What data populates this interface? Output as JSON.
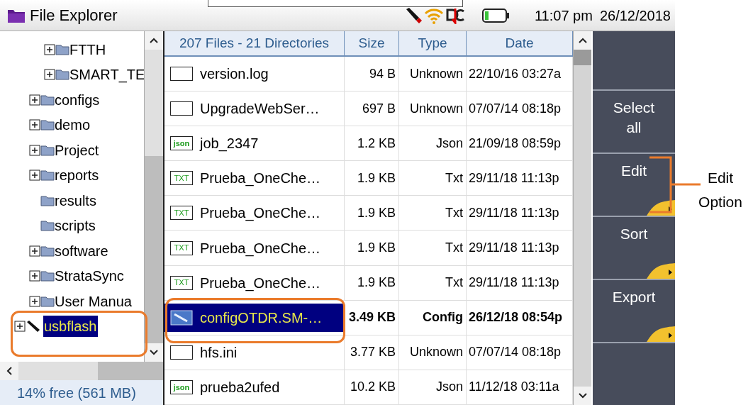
{
  "window": {
    "title": "File Explorer"
  },
  "status_bar": {
    "time": "11:07 pm",
    "date": "26/12/2018"
  },
  "tree": {
    "items": [
      {
        "children": [
          {
            "children": [
              {
                "label": "FTTH",
                "kind": "folder",
                "expandable": true,
                "selected": false
              },
              {
                "label": "SMART_TE",
                "kind": "folder",
                "expandable": true,
                "selected": false
              }
            ]
          },
          {
            "label": "configs",
            "kind": "folder",
            "expandable": true,
            "selected": false
          },
          {
            "label": "demo",
            "kind": "folder",
            "expandable": true,
            "selected": false
          },
          {
            "label": "Project",
            "kind": "folder",
            "expandable": true,
            "selected": false
          },
          {
            "label": "reports",
            "kind": "folder",
            "expandable": true,
            "selected": false
          },
          {
            "label": "results",
            "kind": "folder",
            "expandable": false,
            "selected": false
          },
          {
            "label": "scripts",
            "kind": "folder",
            "expandable": false,
            "selected": false
          },
          {
            "label": "software",
            "kind": "folder",
            "expandable": true,
            "selected": false
          },
          {
            "label": "StrataSync",
            "kind": "folder",
            "expandable": true,
            "selected": false
          },
          {
            "label": "User Manua",
            "kind": "folder",
            "expandable": true,
            "selected": false
          }
        ]
      },
      {
        "label": "usbflash",
        "kind": "drive",
        "expandable": true,
        "selected": true
      }
    ]
  },
  "storage": {
    "free": "14% free (561 MB)"
  },
  "file_list": {
    "columns": [
      "207 Files - 21 Directories",
      "Size",
      "Type",
      "Date"
    ],
    "rows": [
      {
        "kind": "blank",
        "name": "version.log",
        "size": "94 B",
        "type": "Unknown",
        "date": "22/10/16 03:27a",
        "selected": false
      },
      {
        "kind": "blank",
        "name": "UpgradeWebSer…",
        "size": "697 B",
        "type": "Unknown",
        "date": "07/07/14 08:18p",
        "selected": false
      },
      {
        "kind": "json",
        "badge": "json",
        "name": "job_2347",
        "size": "1.2 KB",
        "type": "Json",
        "date": "21/09/18 08:59p",
        "selected": false
      },
      {
        "kind": "txt",
        "badge": "TXT",
        "name": "Prueba_OneChe…",
        "size": "1.9 KB",
        "type": "Txt",
        "date": "29/11/18 11:13p",
        "selected": false
      },
      {
        "kind": "txt",
        "badge": "TXT",
        "name": "Prueba_OneChe…",
        "size": "1.9 KB",
        "type": "Txt",
        "date": "29/11/18 11:13p",
        "selected": false
      },
      {
        "kind": "txt",
        "badge": "TXT",
        "name": "Prueba_OneChe…",
        "size": "1.9 KB",
        "type": "Txt",
        "date": "29/11/18 11:13p",
        "selected": false
      },
      {
        "kind": "txt",
        "badge": "TXT",
        "name": "Prueba_OneChe…",
        "size": "1.9 KB",
        "type": "Txt",
        "date": "29/11/18 11:13p",
        "selected": false
      },
      {
        "kind": "config",
        "name": "configOTDR.SM-…",
        "size": "3.49 KB",
        "type": "Config",
        "date": "26/12/18 08:54p",
        "selected": true
      },
      {
        "kind": "blank",
        "name": "hfs.ini",
        "size": "3.77 KB",
        "type": "Unknown",
        "date": "07/07/14 08:18p",
        "selected": false
      },
      {
        "kind": "json",
        "badge": "json",
        "name": "prueba2ufed",
        "size": "10.2 KB",
        "type": "Json",
        "date": "11/12/18 03:11a",
        "selected": false
      }
    ]
  },
  "softkeys": [
    {
      "label": "Select all",
      "submenu": false
    },
    {
      "label": "Edit",
      "submenu": true
    },
    {
      "label": "Sort",
      "submenu": true
    },
    {
      "label": "Export",
      "submenu": true
    }
  ],
  "callout": {
    "label": "Edit Option"
  }
}
